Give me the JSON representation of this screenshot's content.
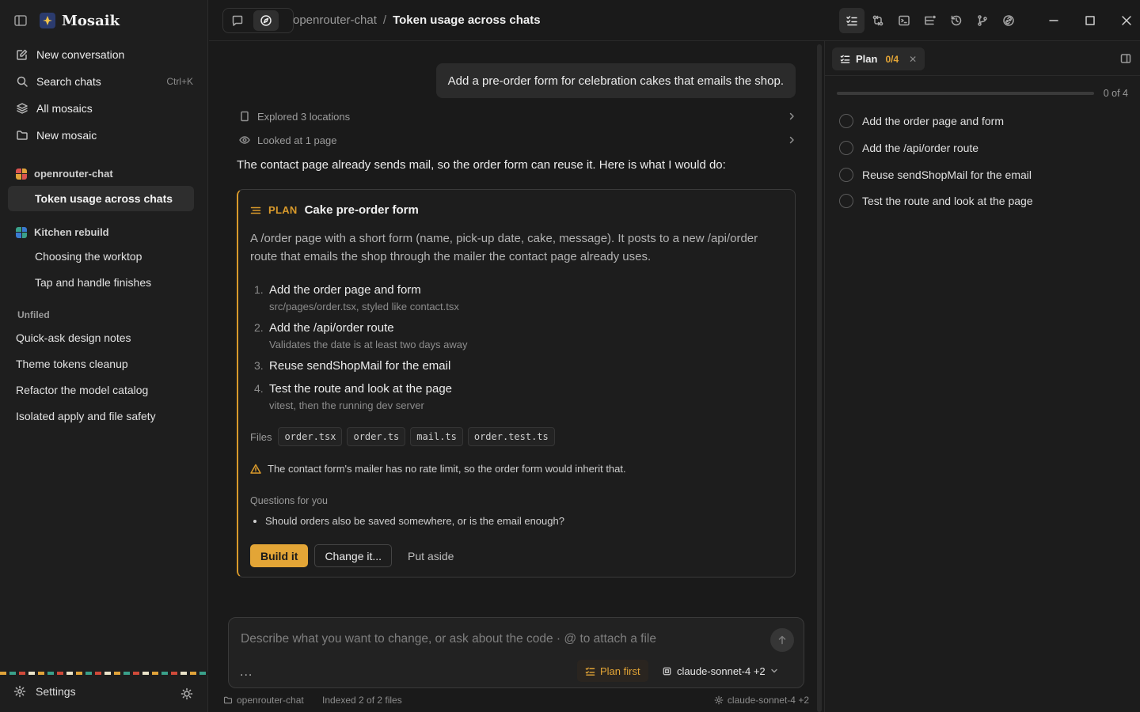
{
  "app": {
    "name": "Mosaik",
    "accent": "#e3a536"
  },
  "sidebar": {
    "nav": [
      {
        "label": "New conversation",
        "icon": "edit-icon"
      },
      {
        "label": "Search chats",
        "icon": "search-icon",
        "shortcut": "Ctrl+K"
      },
      {
        "label": "All mosaics",
        "icon": "layers-icon"
      },
      {
        "label": "New mosaic",
        "icon": "folder-icon"
      }
    ],
    "groups": [
      {
        "name": "openrouter-chat",
        "chats": [
          "Token usage across chats"
        ]
      },
      {
        "name": "Kitchen rebuild",
        "chats": [
          "Choosing the worktop",
          "Tap and handle finishes"
        ]
      }
    ],
    "unfiled_label": "Unfiled",
    "unfiled": [
      "Quick-ask design notes",
      "Theme tokens cleanup",
      "Refactor the model catalog",
      "Isolated apply and file safety"
    ],
    "settings_label": "Settings"
  },
  "topbar": {
    "project": "openrouter-chat",
    "separator": "/",
    "title": "Token usage across chats"
  },
  "chat": {
    "user_message": "Add a pre-order form for celebration cakes that emails the shop.",
    "activity": [
      "Explored 3 locations",
      "Looked at 1 page"
    ],
    "assistant_text": "The contact page already sends mail, so the order form can reuse it. Here is what I would do:",
    "plan": {
      "tag": "PLAN",
      "title": "Cake pre-order form",
      "description": "A /order page with a short form (name, pick-up date, cake, message). It posts to a new /api/order route that emails the shop through the mailer the contact page already uses.",
      "steps": [
        {
          "num": "1.",
          "title": "Add the order page and form",
          "sub": "src/pages/order.tsx, styled like contact.tsx"
        },
        {
          "num": "2.",
          "title": "Add the /api/order route",
          "sub": "Validates the date is at least two days away"
        },
        {
          "num": "3.",
          "title": "Reuse sendShopMail for the email",
          "sub": ""
        },
        {
          "num": "4.",
          "title": "Test the route and look at the page",
          "sub": "vitest, then the running dev server"
        }
      ],
      "files_label": "Files",
      "files": [
        "order.tsx",
        "order.ts",
        "mail.ts",
        "order.test.ts"
      ],
      "warning": "The contact form's mailer has no rate limit, so the order form would inherit that.",
      "questions_label": "Questions for you",
      "questions": [
        "Should orders also be saved somewhere, or is the email enough?"
      ],
      "buttons": {
        "build": "Build it",
        "change": "Change it...",
        "aside": "Put aside"
      }
    }
  },
  "composer": {
    "placeholder": "Describe what you want to change, or ask about the code  ·  @ to attach a file",
    "more": "...",
    "plan_first": "Plan first",
    "model": "claude-sonnet-4 +2"
  },
  "statusbar": {
    "project": "openrouter-chat",
    "indexed": "Indexed 2 of 2 files",
    "model": "claude-sonnet-4 +2"
  },
  "panel": {
    "tab_label": "Plan",
    "count": "0/4",
    "progress_fraction": 0,
    "progress_text": "0 of 4",
    "tasks": [
      "Add the order page and form",
      "Add the /api/order route",
      "Reuse sendShopMail for the email",
      "Test the route and look at the page"
    ]
  }
}
